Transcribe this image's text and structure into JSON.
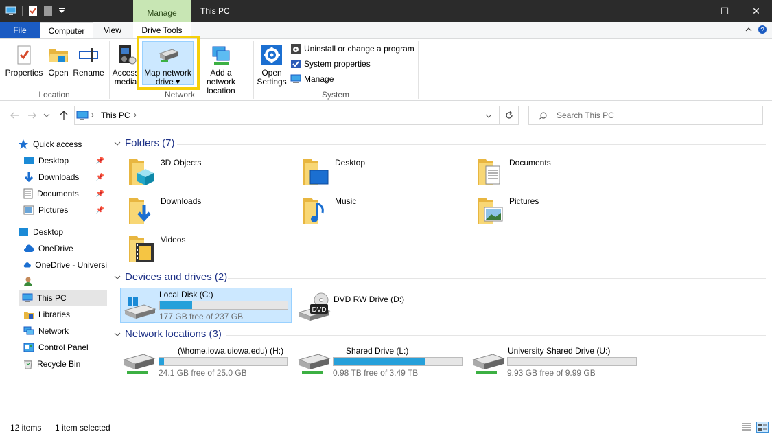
{
  "window": {
    "title": "This PC",
    "context_tab": "Manage",
    "minimize": "—",
    "maximize": "☐",
    "close": "✕"
  },
  "tabs": {
    "file": "File",
    "computer": "Computer",
    "view": "View",
    "drive_tools": "Drive Tools"
  },
  "ribbon": {
    "location": {
      "label": "Location",
      "properties": "Properties",
      "open": "Open",
      "rename": "Rename"
    },
    "network": {
      "label": "Network",
      "access_media_line1": "Access",
      "access_media_line2": "media",
      "map_drive_line1": "Map network",
      "map_drive_line2": "drive",
      "add_location_line1": "Add a network",
      "add_location_line2": "location"
    },
    "system": {
      "label": "System",
      "open_settings_line1": "Open",
      "open_settings_line2": "Settings",
      "uninstall": "Uninstall or change a program",
      "system_properties": "System properties",
      "manage": "Manage"
    }
  },
  "address": {
    "path_root": "This PC",
    "search_placeholder": "Search This PC"
  },
  "sidebar": {
    "quick_access": "Quick access",
    "qa_items": [
      "Desktop",
      "Downloads",
      "Documents",
      "Pictures"
    ],
    "items": [
      "Desktop",
      "OneDrive",
      "OneDrive - Universi",
      "",
      "This PC",
      "Libraries",
      "Network",
      "Control Panel",
      "Recycle Bin"
    ]
  },
  "folders": {
    "header": "Folders (7)",
    "items": [
      "3D Objects",
      "Desktop",
      "Documents",
      "Downloads",
      "Music",
      "Pictures",
      "Videos"
    ]
  },
  "devices": {
    "header": "Devices and drives (2)",
    "local": {
      "name": "Local Disk (C:)",
      "free": "177 GB free of 237 GB",
      "used_fraction": 0.253
    },
    "dvd": {
      "name": "DVD RW Drive (D:)",
      "badge": "DVD"
    }
  },
  "network_locations": {
    "header": "Network locations (3)",
    "items": [
      {
        "name": "(\\\\home.iowa.uiowa.edu) (H:)",
        "free": "24.1 GB free of 25.0 GB",
        "used_fraction": 0.036
      },
      {
        "name": "Shared Drive (L:)",
        "free": "0.98 TB free of 3.49 TB",
        "used_fraction": 0.719
      },
      {
        "name": "University Shared Drive (U:)",
        "free": "9.93 GB free of 9.99 GB",
        "used_fraction": 0.006
      }
    ]
  },
  "status": {
    "items": "12 items",
    "selected": "1 item selected"
  },
  "colors": {
    "accent": "#1b5bc2",
    "highlight": "#f5cf0a",
    "bar_fill": "#26a0da",
    "selected_bg": "#cce8ff",
    "folder": "#f8d775"
  }
}
